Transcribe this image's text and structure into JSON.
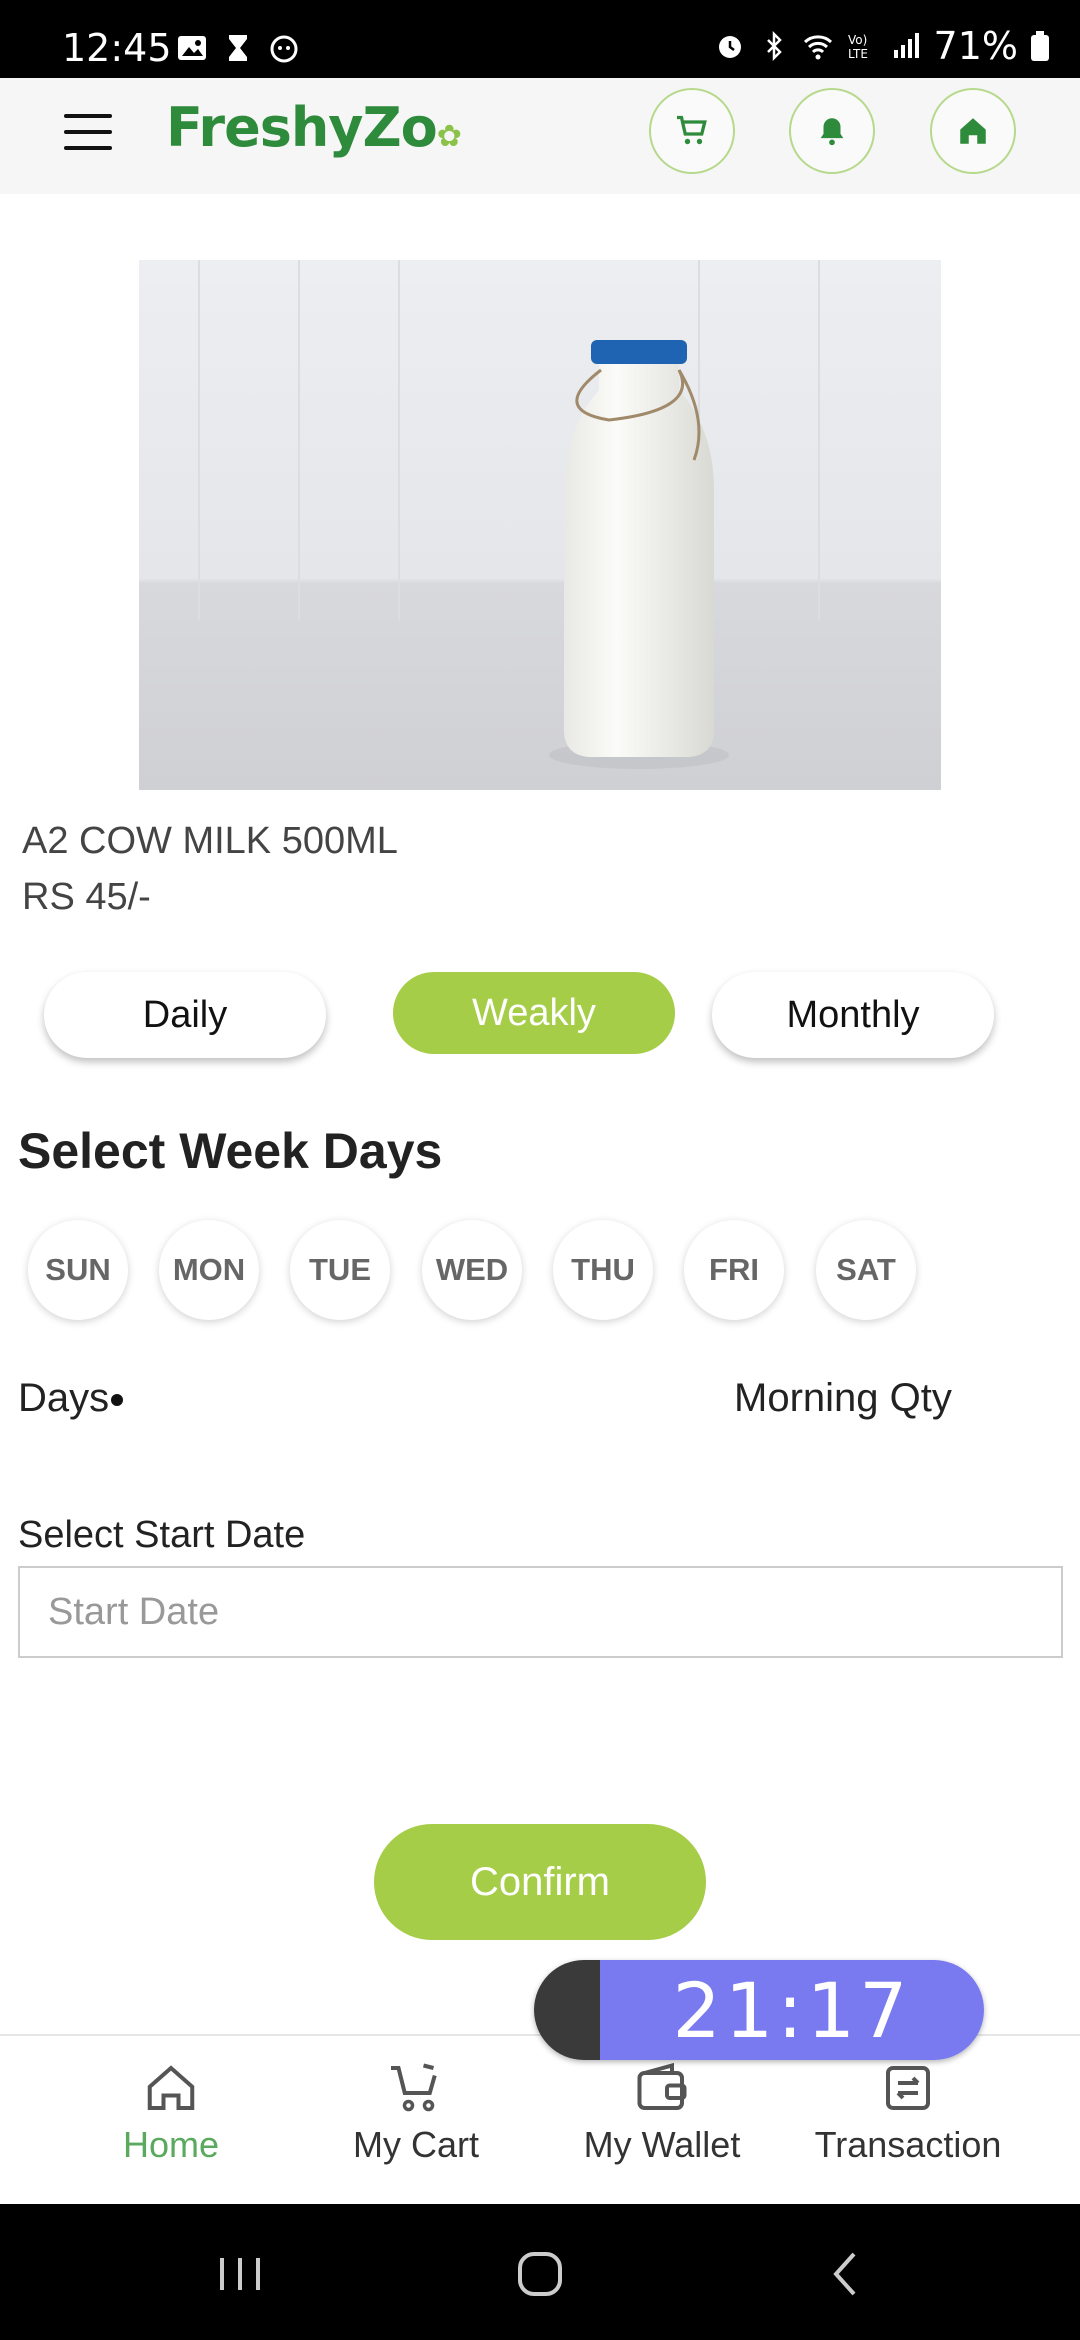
{
  "status_bar": {
    "time": "12:45",
    "battery": "71%"
  },
  "header": {
    "logo_text": "FreshyZo",
    "brand_color": "#2e8b3b",
    "accent_color": "#a6cd48",
    "icons": [
      "menu-icon",
      "cart-icon",
      "bell-icon",
      "home-icon"
    ]
  },
  "product": {
    "name": "A2 COW MILK 500ML",
    "price": "RS 45/-"
  },
  "plans": [
    {
      "label": "Daily",
      "active": false
    },
    {
      "label": "Weakly",
      "active": true
    },
    {
      "label": "Monthly",
      "active": false
    }
  ],
  "week": {
    "title": "Select Week Days",
    "days": [
      "SUN",
      "MON",
      "TUE",
      "WED",
      "THU",
      "FRI",
      "SAT"
    ]
  },
  "labels": {
    "days": "Days",
    "morning_qty": "Morning Qty",
    "select_start_date": "Select Start Date",
    "start_date_placeholder": "Start Date",
    "confirm": "Confirm"
  },
  "timer": {
    "time": "21:17"
  },
  "bottom_nav": [
    {
      "label": "Home",
      "icon": "home-outline-icon",
      "active": true
    },
    {
      "label": "My Cart",
      "icon": "cart-outline-icon",
      "active": false
    },
    {
      "label": "My Wallet",
      "icon": "wallet-icon",
      "active": false
    },
    {
      "label": "Transaction",
      "icon": "transaction-icon",
      "active": false
    }
  ]
}
